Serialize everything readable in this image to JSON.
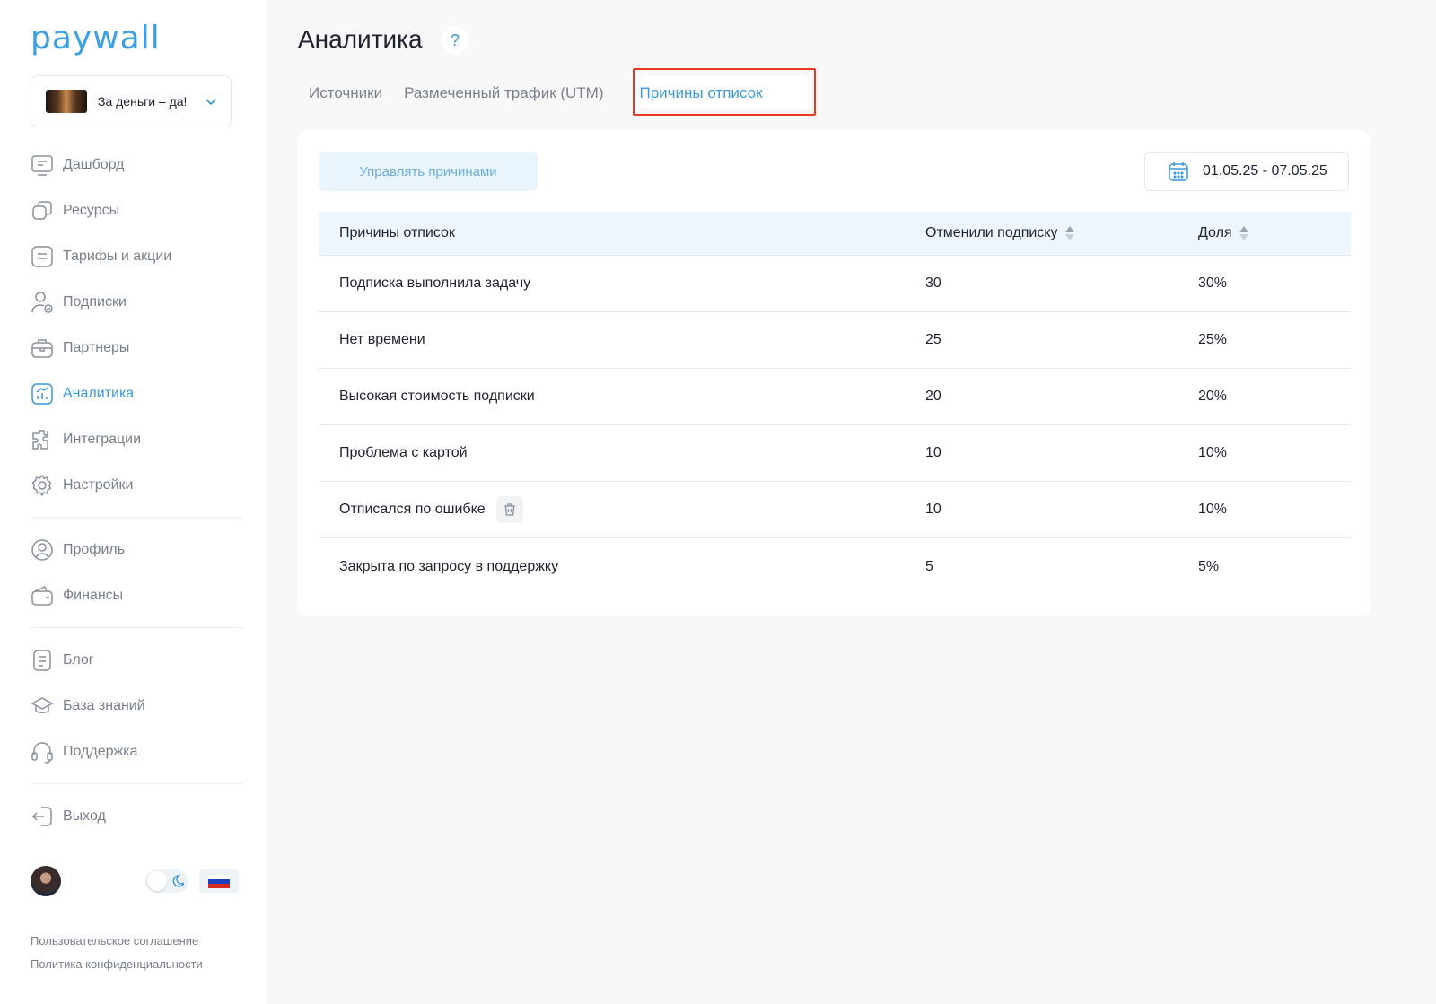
{
  "app": {
    "logo": "paywall"
  },
  "project": {
    "name": "За деньги – да!"
  },
  "nav": {
    "group1": [
      {
        "label": "Дашборд",
        "icon": "dashboard-icon"
      },
      {
        "label": "Ресурсы",
        "icon": "resources-icon"
      },
      {
        "label": "Тарифы и акции",
        "icon": "tariffs-icon"
      },
      {
        "label": "Подписки",
        "icon": "subscriptions-icon"
      },
      {
        "label": "Партнеры",
        "icon": "partners-icon"
      },
      {
        "label": "Аналитика",
        "icon": "analytics-icon",
        "active": true
      },
      {
        "label": "Интеграции",
        "icon": "integrations-icon"
      },
      {
        "label": "Настройки",
        "icon": "settings-icon"
      }
    ],
    "group2": [
      {
        "label": "Профиль",
        "icon": "profile-icon"
      },
      {
        "label": "Финансы",
        "icon": "finances-icon"
      }
    ],
    "group3": [
      {
        "label": "Блог",
        "icon": "blog-icon"
      },
      {
        "label": "База знаний",
        "icon": "knowledge-base-icon"
      },
      {
        "label": "Поддержка",
        "icon": "support-icon"
      }
    ],
    "logout": {
      "label": "Выход",
      "icon": "logout-icon"
    }
  },
  "footer": {
    "terms": "Пользовательское соглашение",
    "privacy": "Политика конфиденциальности"
  },
  "page": {
    "title": "Аналитика",
    "help": "?",
    "tabs": [
      {
        "label": "Источники"
      },
      {
        "label": "Размеченный трафик (UTM)"
      },
      {
        "label": "Причины отписок",
        "active": true
      }
    ]
  },
  "toolbar": {
    "manage_label": "Управлять причинами",
    "date_range": "01.05.25 - 07.05.25"
  },
  "table": {
    "columns": [
      "Причины отписок",
      "Отменили подписку",
      "Доля"
    ],
    "rows": [
      {
        "reason": "Подписка выполнила задачу",
        "cancelled": "30",
        "share": "30%"
      },
      {
        "reason": "Нет времени",
        "cancelled": "25",
        "share": "25%"
      },
      {
        "reason": "Высокая стоимость подписки",
        "cancelled": "20",
        "share": "20%"
      },
      {
        "reason": "Проблема с картой",
        "cancelled": "10",
        "share": "10%"
      },
      {
        "reason": "Отписался по ошибке",
        "cancelled": "10",
        "share": "10%",
        "deletable": true
      },
      {
        "reason": "Закрыта по запросу в поддержку",
        "cancelled": "5",
        "share": "5%"
      }
    ]
  },
  "colors": {
    "accent": "#3a98dc",
    "highlight": "#e53924",
    "header_bg": "#eef6fd"
  }
}
